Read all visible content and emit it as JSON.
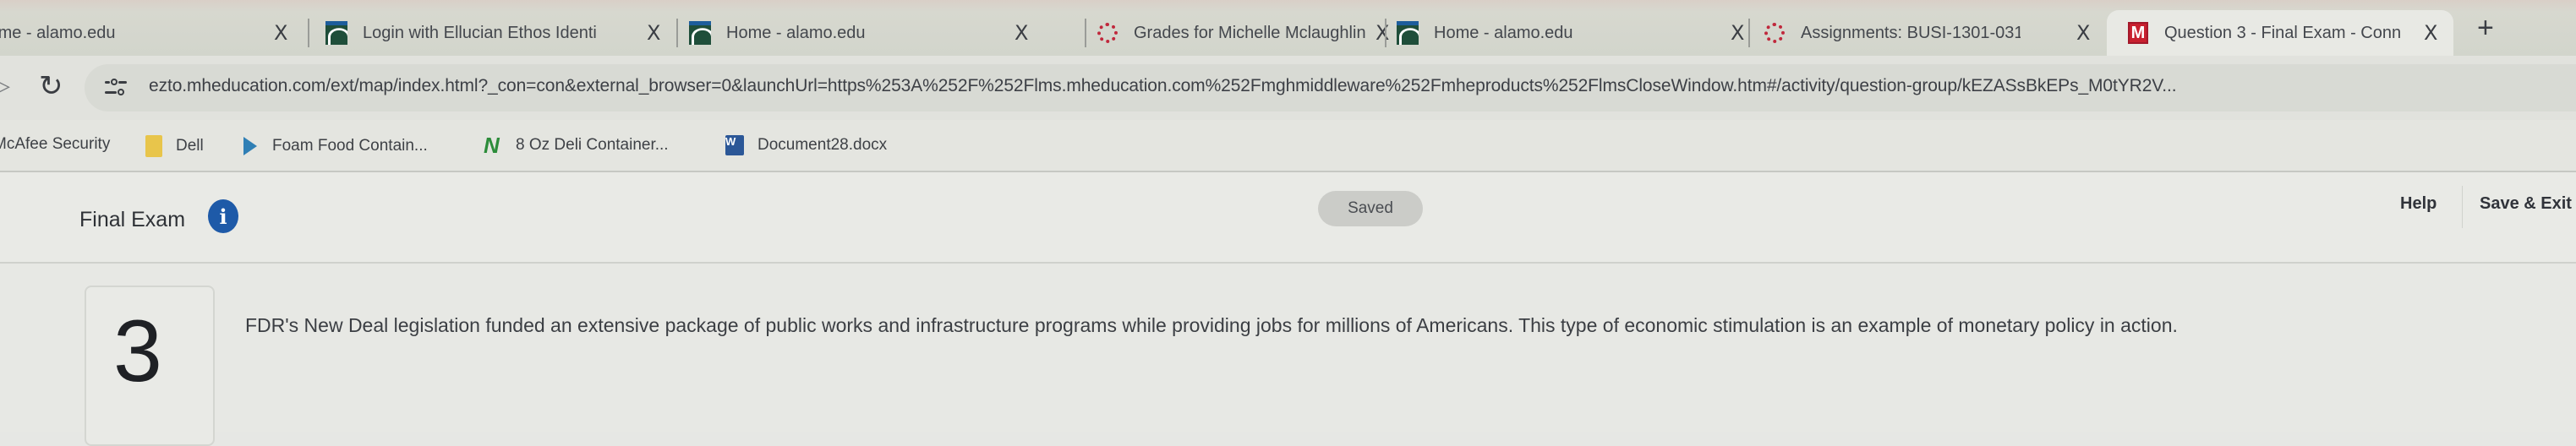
{
  "browser": {
    "tabs": [
      {
        "title": "Home - alamo.edu",
        "icon": "ellucian-icon",
        "active": false
      },
      {
        "title": "Login with Ellucian Ethos Identi",
        "icon": "ellucian-icon",
        "active": false
      },
      {
        "title": "Home - alamo.edu",
        "icon": "ellucian-icon",
        "active": false
      },
      {
        "title": "Grades for Michelle Mclaughlin",
        "icon": "canvas-icon",
        "active": false
      },
      {
        "title": "Home - alamo.edu",
        "icon": "ellucian-icon",
        "active": false
      },
      {
        "title": "Assignments: BUSI-1301-031",
        "icon": "canvas-icon",
        "active": false
      },
      {
        "title": "Question 3 - Final Exam - Conn",
        "icon": "mcgraw-hill-icon",
        "active": true
      }
    ],
    "close_glyph": "X",
    "new_tab_glyph": "+",
    "url": "ezto.mheducation.com/ext/map/index.html?_con=con&external_browser=0&launchUrl=https%253A%252F%252Flms.mheducation.com%252Fmghmiddleware%252Fmheproducts%252FlmsCloseWindow.htm#/activity/question-group/kEZASsBkEPs_M0tYR2V...",
    "reload_glyph": "C",
    "bookmarks": [
      {
        "label": "McAfee Security",
        "icon": "mcafee-icon"
      },
      {
        "label": "Dell",
        "icon": "folder-icon"
      },
      {
        "label": "Foam Food Contain...",
        "icon": "foam-site-icon"
      },
      {
        "label": "8 Oz Deli Container...",
        "icon": "deli-site-icon"
      },
      {
        "label": "Document28.docx",
        "icon": "word-doc-icon"
      }
    ]
  },
  "header": {
    "exam_title": "Final Exam",
    "info_glyph": "i",
    "status_badge": "Saved",
    "help_label": "Help",
    "save_exit_label": "Save & Exit"
  },
  "question": {
    "number": "3",
    "text": "FDR's New Deal legislation funded an extensive package of public works and infrastructure programs while providing jobs for millions of Americans. This type of economic stimulation is an example of monetary policy in action."
  },
  "colors": {
    "info_icon": "#1e5aa8",
    "mcgraw_hill_red": "#c8202f",
    "canvas_red": "#c0283c",
    "ellucian_green": "#1f4e3a"
  }
}
